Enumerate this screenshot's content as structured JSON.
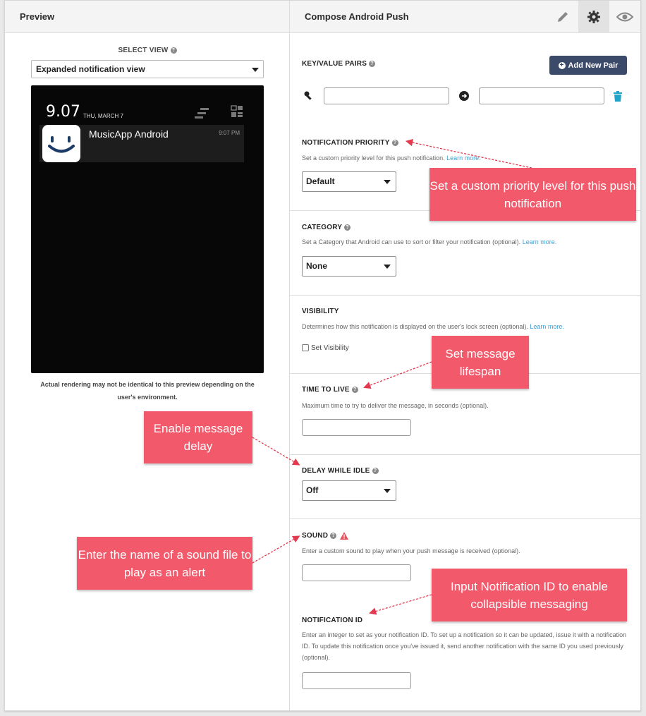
{
  "preview": {
    "header_title": "Preview",
    "select_view_label": "SELECT VIEW",
    "select_view_value": "Expanded notification view",
    "phone": {
      "time": "9.07",
      "date": "THU, MARCH 7",
      "app_name": "MusicApp Android",
      "notif_time": "9:07 PM"
    },
    "note": "Actual rendering may not be identical to this preview depending on the user's environment."
  },
  "compose": {
    "header_title": "Compose Android Push",
    "toolbar_icons": [
      "pencil-icon",
      "gear-icon",
      "eye-icon"
    ],
    "active_icon": "gear-icon",
    "kv": {
      "label": "KEY/VALUE PAIRS",
      "add_button": "Add New Pair",
      "key_value": "",
      "value_value": ""
    },
    "priority": {
      "label": "NOTIFICATION PRIORITY",
      "desc": "Set a custom priority level for this push notification.",
      "link": "Learn more.",
      "selected": "Default"
    },
    "category": {
      "label": "CATEGORY",
      "desc": "Set a Category that Android can use to sort or filter your notification (optional).",
      "link": "Learn more.",
      "selected": "None"
    },
    "visibility": {
      "label": "VISIBILITY",
      "desc": "Determines how this notification is displayed on the user's lock screen (optional).",
      "link": "Learn more.",
      "checkbox_label": "Set Visibility",
      "checked": false
    },
    "ttl": {
      "label": "TIME TO LIVE",
      "desc": "Maximum time to try to deliver the message, in seconds (optional).",
      "value": ""
    },
    "delay": {
      "label": "DELAY WHILE IDLE",
      "selected": "Off"
    },
    "sound": {
      "label": "SOUND",
      "desc": "Enter a custom sound to play when your push message is received (optional).",
      "value": ""
    },
    "notification_id": {
      "label": "NOTIFICATION ID",
      "desc": "Enter an integer to set as your notification ID. To set up a notification so it can be updated, issue it with a notification ID. To update this notification once you've issued it, send another notification with the same ID you used previously (optional).",
      "value": ""
    }
  },
  "annotations": {
    "priority": "Set a custom priority level for this push notification",
    "lifespan": "Set message lifespan",
    "delay": "Enable message delay",
    "sound": "Enter the name of a sound file to play as an alert",
    "notification_id": "Input Notification ID to enable collapsible messaging"
  },
  "colors": {
    "accent": "#3c4a6a",
    "annotation": "#f25a6c",
    "link": "#3a9fd6",
    "trash": "#1fa3c9"
  }
}
